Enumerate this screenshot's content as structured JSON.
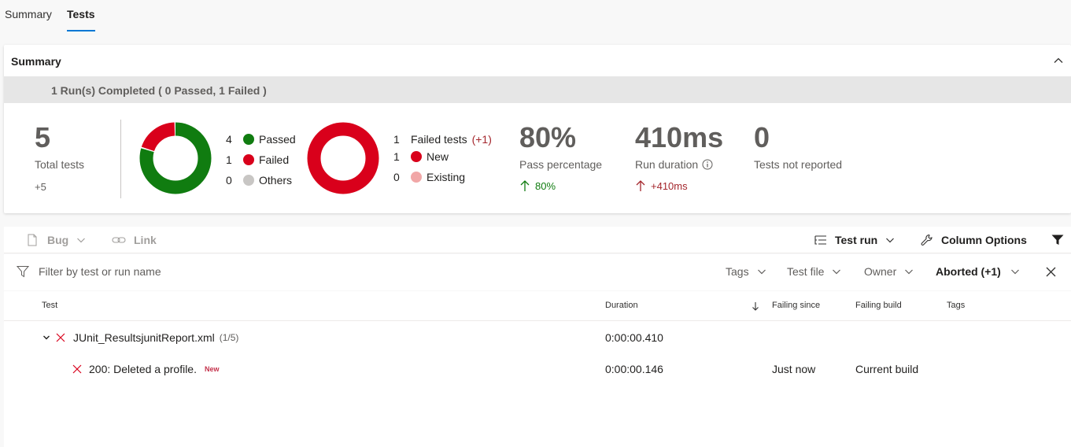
{
  "tabs": [
    {
      "label": "Summary",
      "active": false
    },
    {
      "label": "Tests",
      "active": true
    }
  ],
  "summary": {
    "title": "Summary",
    "run_banner": "1 Run(s) Completed ( 0 Passed, 1 Failed )",
    "total_tests": {
      "value": "5",
      "label": "Total tests",
      "delta": "+5"
    },
    "outcome_legend": [
      {
        "count": "4",
        "label": "Passed",
        "color": "#107c10"
      },
      {
        "count": "1",
        "label": "Failed",
        "color": "#d9001b"
      },
      {
        "count": "0",
        "label": "Others",
        "color": "#c8c6c4"
      }
    ],
    "outcome_donut": {
      "passed": 4,
      "failed": 1,
      "others": 0
    },
    "failed_legend": [
      {
        "count": "1",
        "label": "Failed tests",
        "extra": "(+1)",
        "color": ""
      },
      {
        "count": "1",
        "label": "New",
        "color": "#d9001b"
      },
      {
        "count": "0",
        "label": "Existing",
        "color": "#f1a7a7"
      }
    ],
    "failed_donut": {
      "new": 1,
      "existing": 0
    },
    "pass_percentage": {
      "value": "80%",
      "label": "Pass percentage",
      "delta": "80%",
      "color": "#107c10"
    },
    "run_duration": {
      "value": "410ms",
      "label": "Run duration",
      "delta": "+410ms",
      "color": "#a4262c"
    },
    "not_reported": {
      "value": "0",
      "label": "Tests not reported"
    }
  },
  "toolbar": {
    "bug_label": "Bug",
    "link_label": "Link",
    "test_run_label": "Test run",
    "column_options_label": "Column Options"
  },
  "filters": {
    "search_placeholder": "Filter by test or run name",
    "tags_label": "Tags",
    "test_file_label": "Test file",
    "owner_label": "Owner",
    "outcome_label": "Aborted (+1)"
  },
  "table": {
    "headers": {
      "test": "Test",
      "duration": "Duration",
      "failing_since": "Failing since",
      "failing_build": "Failing build",
      "tags": "Tags"
    },
    "group": {
      "name": "JUnit_ResultsjunitReport.xml",
      "count": "(1/5)",
      "duration": "0:00:00.410"
    },
    "rows": [
      {
        "name": "200: Deleted a profile.",
        "badge": "New",
        "duration": "0:00:00.146",
        "failing_since": "Just now",
        "failing_build": "Current build"
      }
    ]
  }
}
